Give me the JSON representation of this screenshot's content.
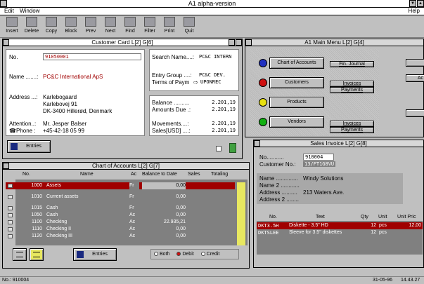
{
  "app": {
    "title": "A1 alpha-version"
  },
  "menu": {
    "edit": "Edit",
    "window": "Window",
    "help": "Help"
  },
  "toolbar": {
    "items": [
      "Insert",
      "Delete",
      "Copy",
      "Block",
      "Prev",
      "Next",
      "Find",
      "Filter",
      "Print",
      "Quit"
    ]
  },
  "customer_card": {
    "title": "Customer Card L[2] G[6]",
    "no_label": "No.",
    "no_value": "91050001",
    "name_label": "Name .......:",
    "name_value": "PC&C International ApS",
    "address_label": "Address ...:",
    "address_lines": [
      "Karlebogaard",
      "Karlebovej 91",
      "DK-3400  Hillerød, Denmark"
    ],
    "attention_label": "Attention..:",
    "attention_value": "Mr. Jesper Balser",
    "phone_label": "Phone :",
    "phone_value": "+45-42-18 05 99",
    "search_label": "Search Name....:",
    "search_value": "PC&C INTERN",
    "entry_group_label": "Entry Group ....:",
    "entry_group_value": "PC&C DEV.",
    "terms_label": "Terms of Paym",
    "terms_value": "UPONREC",
    "balance_label": "Balance ..........",
    "balance_value": "2.201,19",
    "amounts_due_label": "Amounts Due .:",
    "amounts_due_value": "2.201,19",
    "movements_label": "Movements....:",
    "movements_value": "2.201,19",
    "sales_label": "Sales[USD] ....:",
    "sales_value": "2.201,19",
    "entries_button": "Entries"
  },
  "main_menu": {
    "title": "A1 Main Menu L[2] G[4]",
    "buttons": [
      "Chart of Accounts",
      "Customers",
      "Products",
      "Vendors"
    ],
    "fin_journal": "Fin. Journal",
    "invoices": "Invoices",
    "payments": "Payments",
    "right_partial": [
      "Ac"
    ],
    "colors": [
      "#2030c0",
      "#d01010",
      "#e8e010",
      "#10b010"
    ]
  },
  "chart_of_accounts": {
    "title": "Chart of Accounts L[2] G[7]",
    "headers": [
      "No.",
      "Name",
      "Ac",
      "Balance to Date",
      "Sales",
      "Totaling"
    ],
    "rows": [
      {
        "no": "1000",
        "name": "Assets",
        "ac": "Fr",
        "balance": "0,00"
      },
      {
        "no": "1010",
        "name": "  Current assets",
        "ac": "Fr",
        "balance": "0,00"
      },
      {
        "no": "1015",
        "name": "    Cash",
        "ac": "Fr",
        "balance": "0,00"
      },
      {
        "no": "1050",
        "name": "      Cash",
        "ac": "Ac",
        "balance": "0,00"
      },
      {
        "no": "1100",
        "name": "      Checking",
        "ac": "Ac",
        "balance": "22.935,21"
      },
      {
        "no": "1110",
        "name": "      Checking II",
        "ac": "Ac",
        "balance": "0,00"
      },
      {
        "no": "1120",
        "name": "      Checking III",
        "ac": "Ac",
        "balance": "0,00"
      }
    ],
    "entries_button": "Entries",
    "radio_both": "Both",
    "radio_debit": "Debit",
    "radio_credit": "Credit"
  },
  "sales_invoice": {
    "title": "Sales Invoice L[2] G[8]",
    "no_label": "No...........",
    "no_value": "910004",
    "customer_no_label": "Customer No.:",
    "customer_no_value": "13/FT1G8VU",
    "name_label": "Name ..............",
    "name_value": "Windy Solutions",
    "name2_label": "Name 2 ............",
    "address_label": "Address ..........",
    "address_value": "213 Waters Ave.",
    "address2_label": "Address 2 ........",
    "headers": [
      "No.",
      "Text",
      "Qty",
      "Unit",
      "Unit Pric"
    ],
    "rows": [
      {
        "no": "DKT3.5H",
        "text": "Diskette - 3.5\" HD",
        "qty": "12",
        "unit": "pcs",
        "price": "12,00"
      },
      {
        "no": "DKTSLEE",
        "text": "Sleeve for 3.5\" diskettes",
        "qty": "12",
        "unit": "pcs",
        "price": ""
      }
    ]
  },
  "status": {
    "left": "No.: 910004",
    "date": "31-05-96",
    "time": "14.43.27"
  }
}
